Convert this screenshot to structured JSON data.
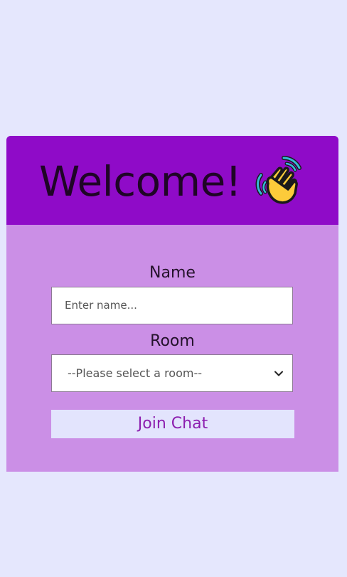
{
  "header": {
    "title": "Welcome!",
    "icon": "waving-hand-icon"
  },
  "form": {
    "name_label": "Name",
    "name_placeholder": "Enter name...",
    "room_label": "Room",
    "room_selected": "--Please select a room--",
    "room_icon": "chevron-down-icon",
    "join_label": "Join Chat"
  },
  "colors": {
    "page_background": "#e5e7fd",
    "header_background": "#8f0bc8",
    "card_background": "#cb8fe6",
    "button_background": "#e3e4fd",
    "button_text": "#8c1eaf"
  }
}
